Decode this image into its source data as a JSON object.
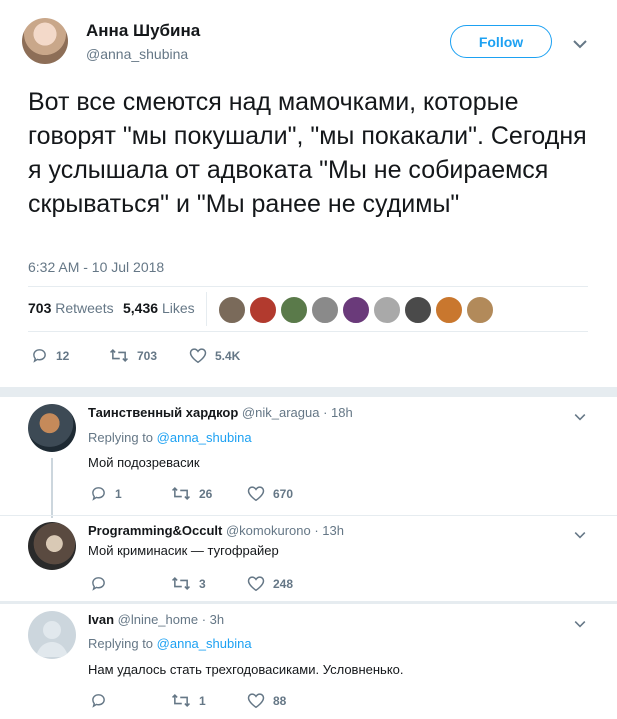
{
  "main_tweet": {
    "author_name": "Анна Шубина",
    "author_handle": "@anna_shubina",
    "follow_label": "Follow",
    "text": "Вот все смеются над мамочками, которые говорят \"мы покушали\", \"мы покакали\". Сегодня я услышала от адвоката \"Мы не собираемся скрываться\" и \"Мы ранее не судимы\"",
    "timestamp": "6:32 AM - 10 Jul 2018",
    "retweets_count": "703",
    "retweets_label": "Retweets",
    "likes_count": "5,436",
    "likes_label": "Likes",
    "actions": {
      "replies": "12",
      "retweets": "703",
      "likes": "5.4K"
    }
  },
  "replies": [
    {
      "author_name": "Таинственный хардкор",
      "author_handle": "@nik_aragua",
      "time": "· 18h",
      "replying_prefix": "Replying to",
      "replying_to": "@anna_shubina",
      "text": "Мой подозревасик",
      "actions": {
        "replies": "1",
        "retweets": "26",
        "likes": "670"
      }
    },
    {
      "author_name": "Programming&Occult",
      "author_handle": "@komokurono",
      "time": "· 13h",
      "text": "Мой криминасик — тугофрайер",
      "actions": {
        "replies": "",
        "retweets": "3",
        "likes": "248"
      }
    },
    {
      "author_name": "Ivan",
      "author_handle": "@lnine_home",
      "time": "· 3h",
      "replying_prefix": "Replying to",
      "replying_to": "@anna_shubina",
      "text": "Нам удалось стать трехгодовасиками. Условненько.",
      "actions": {
        "replies": "",
        "retweets": "1",
        "likes": "88"
      }
    }
  ],
  "colors": {
    "accent": "#1da1f2",
    "muted": "#657786",
    "divider": "#e6ecf0"
  },
  "icons": [
    "chevron-down-icon",
    "reply-icon",
    "retweet-icon",
    "like-icon"
  ]
}
